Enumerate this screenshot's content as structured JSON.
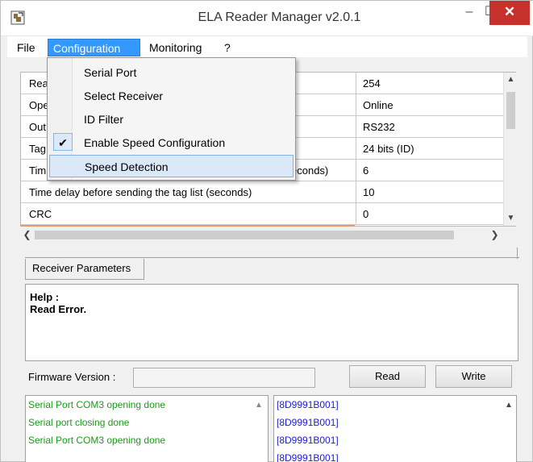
{
  "window": {
    "title": "ELA Reader Manager v2.0.1",
    "minimize_glyph": "–",
    "maximize_glyph": "☐",
    "close_glyph": "✕"
  },
  "menubar": {
    "file": "File",
    "configuration": "Configuration",
    "monitoring": "Monitoring",
    "help": "?"
  },
  "dropdown": {
    "items": [
      {
        "label": "Serial Port"
      },
      {
        "label": "Select Receiver"
      },
      {
        "label": "ID Filter"
      },
      {
        "label": "Enable Speed Configuration",
        "checked": true,
        "check_glyph": "✔"
      },
      {
        "label": "Speed Detection"
      }
    ]
  },
  "grid": {
    "rows": [
      {
        "name": "Rea",
        "value": "254"
      },
      {
        "name": "Ope",
        "value": "Online"
      },
      {
        "name": "Out",
        "value": "RS232"
      },
      {
        "name": "Tag",
        "value": "24 bits (ID)"
      },
      {
        "name": "Tim",
        "name_tail": "econds)",
        "value": "6"
      },
      {
        "name": "Time delay before sending the tag list (seconds)",
        "value": "10"
      },
      {
        "name": "CRC",
        "value": "0"
      }
    ]
  },
  "tabs": {
    "receiver_parameters": "Receiver Parameters"
  },
  "help_panel": {
    "heading": "Help :",
    "message": "Read Error."
  },
  "firmware": {
    "label": "Firmware Version :",
    "value": ""
  },
  "buttons": {
    "read": "Read",
    "write": "Write"
  },
  "log_left": [
    "Serial Port COM3 opening done",
    "Serial port closing done",
    "Serial Port COM3 opening done"
  ],
  "log_right": [
    "[8D9991B001]",
    "[8D9991B001]",
    "[8D9991B001]",
    "[8D9991B001]"
  ],
  "icons": {
    "app": "ela-app-icon",
    "scroll_up": "chevron-up-icon",
    "scroll_down": "chevron-down-icon",
    "scroll_left": "chevron-left-icon",
    "scroll_right": "chevron-right-icon"
  },
  "colors": {
    "menu_highlight": "#3399ff",
    "close_button": "#c7312c",
    "log_green": "#1b9a1b",
    "log_blue": "#1b1be0"
  }
}
